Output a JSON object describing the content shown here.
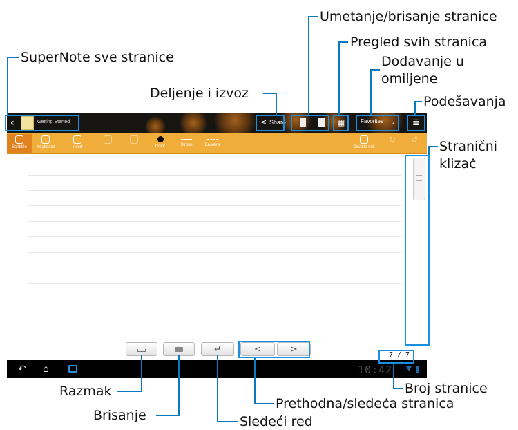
{
  "callouts": {
    "umetanje": "Umetanje/brisanje stranice",
    "pregled": "Pregled svih stranica",
    "omiljene_1": "Dodavanje u",
    "omiljene_2": "omiljene",
    "supernote": "SuperNote sve stranice",
    "deljenje": "Deljenje i izvoz",
    "podesavanja": "Podešavanja",
    "klizac_1": "Stranični",
    "klizac_2": "klizač",
    "broj": "Broj stranice",
    "prethodna": "Prethodna/sledeća stranica",
    "razmak": "Razmak",
    "brisanje": "Brisanje",
    "sledeci_red": "Sledeći red"
  },
  "app": {
    "notebook_title": "Getting Started",
    "share_label": "Share",
    "favorites_label": "Favorites",
    "page_counter": "7 / 7",
    "clock": "10:42"
  },
  "toolbar": {
    "scribble": "Scribble",
    "keyboard": "Keyboard",
    "insert": "Insert",
    "color": "Color",
    "stroke": "Stroke",
    "baseline": "Baseline",
    "disable_edit": "Disable edit"
  },
  "keys": {
    "prev": "<",
    "next": ">"
  },
  "colors": {
    "callout_line": "#0a79c2",
    "toolbar_bg": "#f0ad3a"
  }
}
